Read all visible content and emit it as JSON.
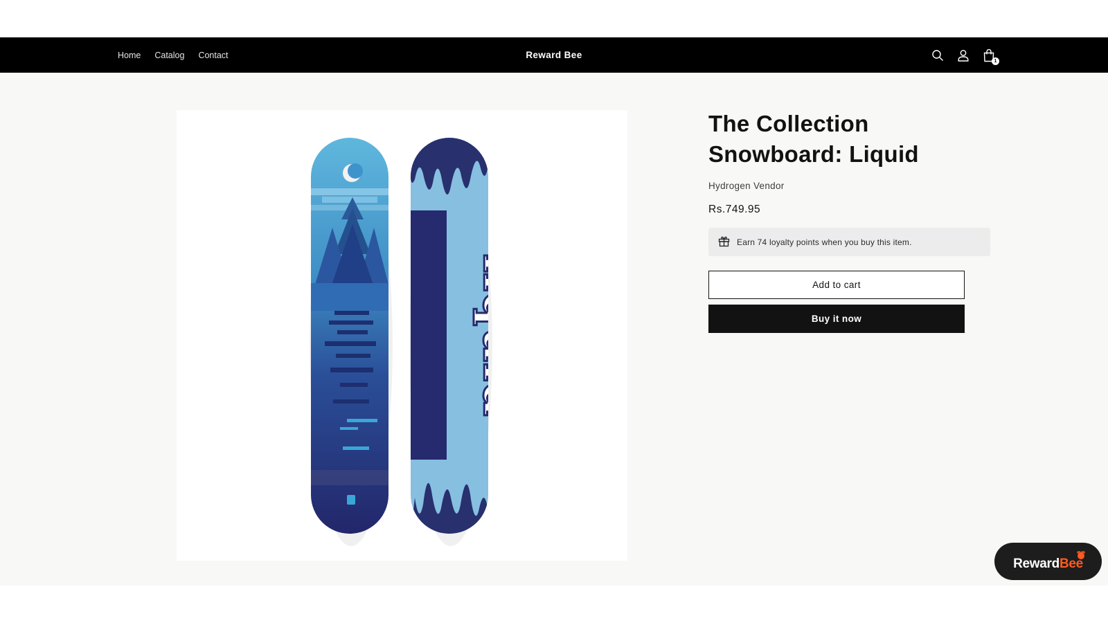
{
  "header": {
    "nav": [
      {
        "label": "Home"
      },
      {
        "label": "Catalog"
      },
      {
        "label": "Contact"
      }
    ],
    "brand": "Reward Bee",
    "icons": [
      "search-icon",
      "account-icon",
      "cart-icon"
    ],
    "cart_count": "1"
  },
  "product": {
    "image_text": "liquid",
    "title": "The Collection Snowboard: Liquid",
    "vendor": "Hydrogen Vendor",
    "price": "Rs.749.95",
    "loyalty_text": "Earn 74 loyalty points when you buy this item.",
    "add_to_cart_label": "Add to cart",
    "buy_now_label": "Buy it now"
  },
  "launcher": {
    "label_part1": "Reward",
    "label_part2": "Bee"
  },
  "colors": {
    "header_bg": "#000000",
    "page_bg": "#f8f8f6",
    "accent_orange": "#ff5a1f",
    "button_dark": "#121212",
    "loyalty_bg": "#ececec"
  }
}
